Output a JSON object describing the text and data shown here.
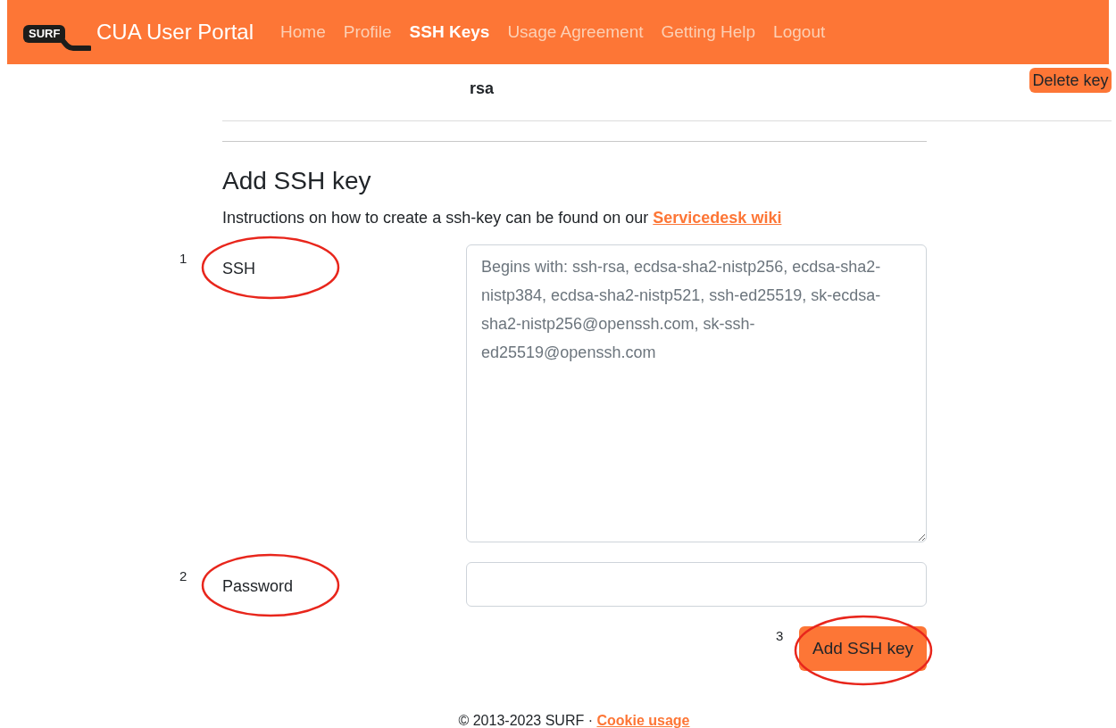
{
  "header": {
    "logo": "SURF",
    "title": "CUA User Portal",
    "nav": [
      {
        "label": "Home",
        "selected": false
      },
      {
        "label": "Profile",
        "selected": false
      },
      {
        "label": "SSH Keys",
        "selected": true
      },
      {
        "label": "Usage Agreement",
        "selected": false
      },
      {
        "label": "Getting Help",
        "selected": false
      },
      {
        "label": "Logout",
        "selected": false
      }
    ]
  },
  "key_row": {
    "type": "rsa",
    "button": "Delete key"
  },
  "form": {
    "heading": "Add SSH key",
    "instructions": "Instructions on how to create a ssh-key can be found on our",
    "link": "Servicedesk wiki",
    "fields": [
      {
        "kind": "textarea",
        "label": "SSH",
        "placeholder": "Begins with: ssh-rsa, ecdsa-sha2-nistp256, ecdsa-sha2-nistp384, ecdsa-sha2-nistp521, ssh-ed25519, sk-ecdsa-sha2-nistp256@openssh.com, sk-ssh-ed25519@openssh.com",
        "annotation": "1"
      },
      {
        "kind": "input",
        "label": "Password",
        "annotation": "2"
      }
    ],
    "submit": {
      "label": "Add SSH key",
      "annotation": "3"
    }
  },
  "footer": {
    "text": "© 2013-2023 SURF ·",
    "link": "Cookie usage"
  }
}
